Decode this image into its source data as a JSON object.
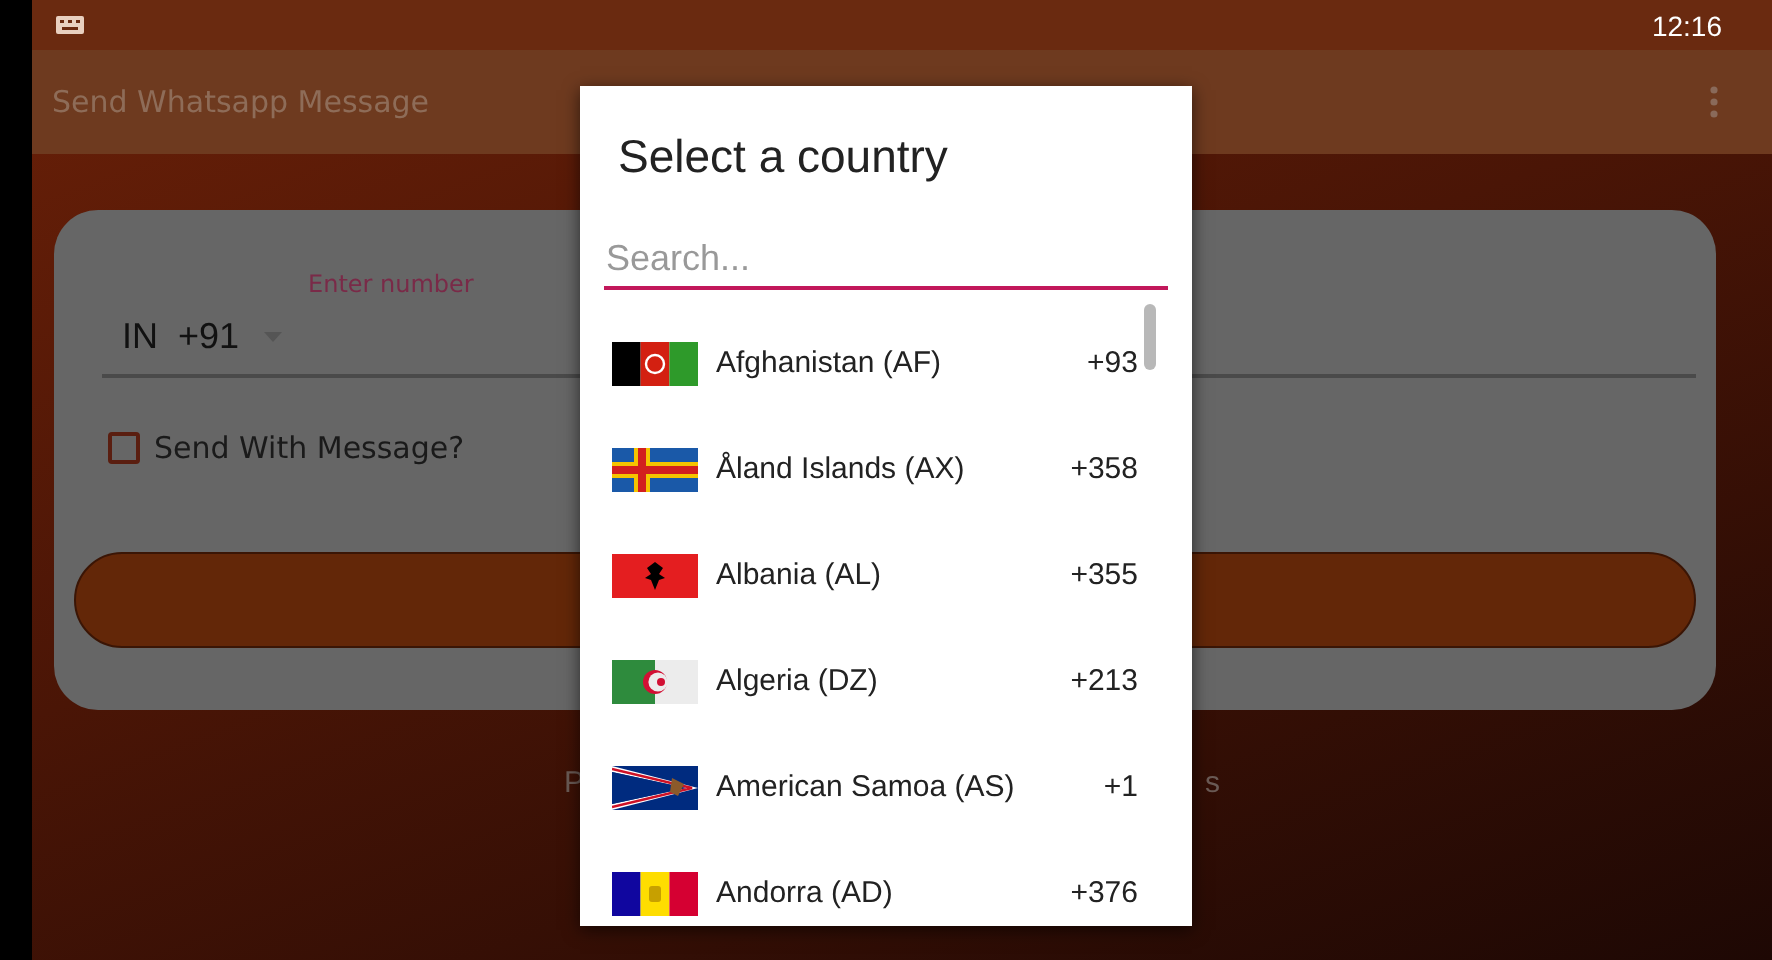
{
  "status_bar": {
    "time": "12:16"
  },
  "app_bar": {
    "title": "Send Whatsapp Message"
  },
  "form": {
    "number_label": "Enter number",
    "country_code": "IN  +91",
    "checkbox": {
      "label": "Send With Message?",
      "checked": false
    }
  },
  "footer": {
    "left_fragment": "P",
    "right_fragment": "s"
  },
  "dialog": {
    "title": "Select a country",
    "search": {
      "placeholder": "Search..."
    },
    "countries": [
      {
        "name": "Afghanistan (AF)",
        "code": "+93"
      },
      {
        "name": "Åland Islands (AX)",
        "code": "+358"
      },
      {
        "name": "Albania (AL)",
        "code": "+355"
      },
      {
        "name": "Algeria (DZ)",
        "code": "+213"
      },
      {
        "name": "American Samoa (AS)",
        "code": "+1"
      },
      {
        "name": "Andorra (AD)",
        "code": "+376"
      }
    ]
  }
}
